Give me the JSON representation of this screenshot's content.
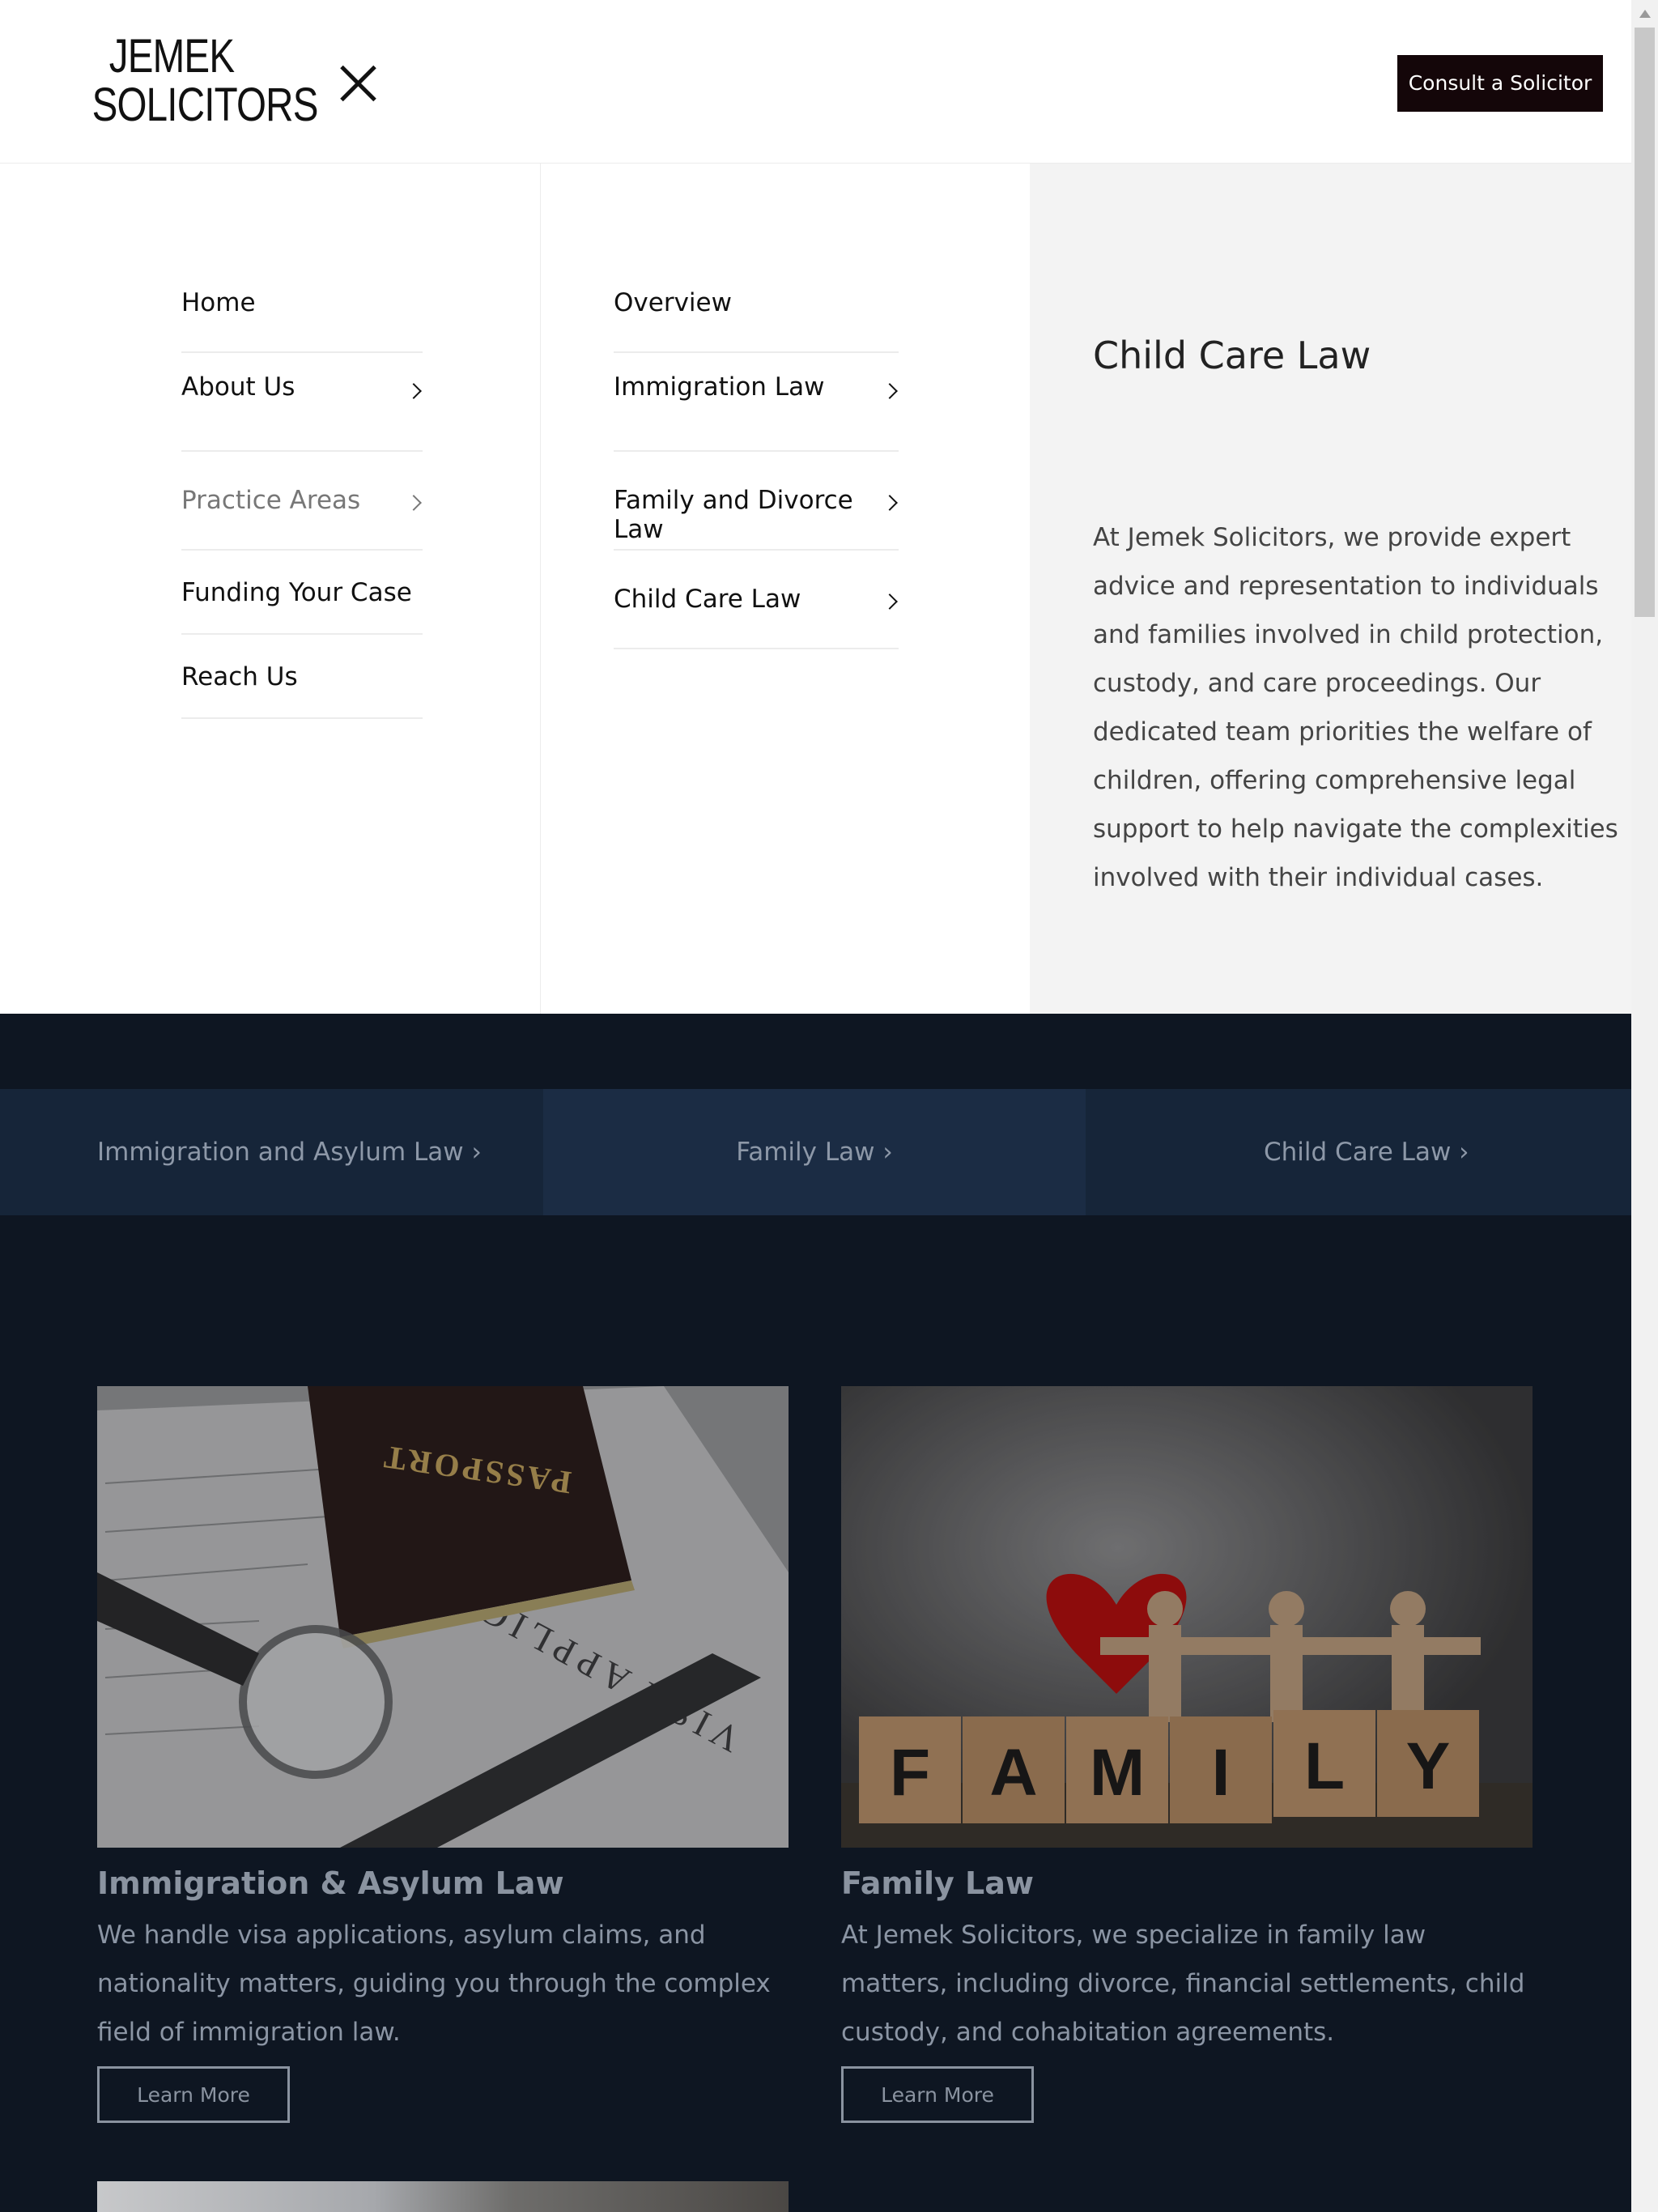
{
  "header": {
    "logo_line1": "JEMEK",
    "logo_line2": "SOLICITORS",
    "consult_label": "Consult a Solicitor"
  },
  "menu": {
    "primary": [
      {
        "label": "Home"
      },
      {
        "label": "About Us"
      },
      {
        "label": "Practice Areas"
      },
      {
        "label": "Funding Your Case"
      },
      {
        "label": "Reach Us"
      }
    ],
    "secondary": [
      {
        "label": "Overview"
      },
      {
        "label": "Immigration Law"
      },
      {
        "label": "Family and Divorce Law"
      },
      {
        "label": "Child Care Law"
      }
    ],
    "detail": {
      "title": "Child Care Law",
      "text": "At Jemek Solicitors, we provide expert advice and representation to individuals and families involved in child protection, custody, and care proceedings. Our dedicated team priorities the welfare of children, offering comprehensive legal support to help navigate the complexities involved with their individual cases."
    }
  },
  "tabs": [
    {
      "label": "Immigration and Asylum Law ›"
    },
    {
      "label": "Family Law ›"
    },
    {
      "label": "Child Care Law ›"
    }
  ],
  "cards": [
    {
      "title": "Immigration & Asylum Law",
      "text": "We handle visa applications, asylum claims, and nationality matters, guiding you through the complex field of immigration law.",
      "button": "Learn More",
      "image_words": [
        "PASSPORT",
        "VISA APPLICATION"
      ]
    },
    {
      "title": "Family Law",
      "text": "At Jemek Solicitors, we specialize in family law matters, including divorce, financial settlements, child custody, and cohabitation agreements.",
      "button": "Learn More",
      "image_letters": [
        "F",
        "A",
        "M",
        "I",
        "L",
        "Y"
      ]
    }
  ],
  "colors": {
    "page_bg": "#0e1622",
    "tab_bg": "#162539",
    "tab_active_bg": "#1b2c44",
    "consult_bg": "#140609",
    "detail_bg": "#f3f3f3"
  }
}
